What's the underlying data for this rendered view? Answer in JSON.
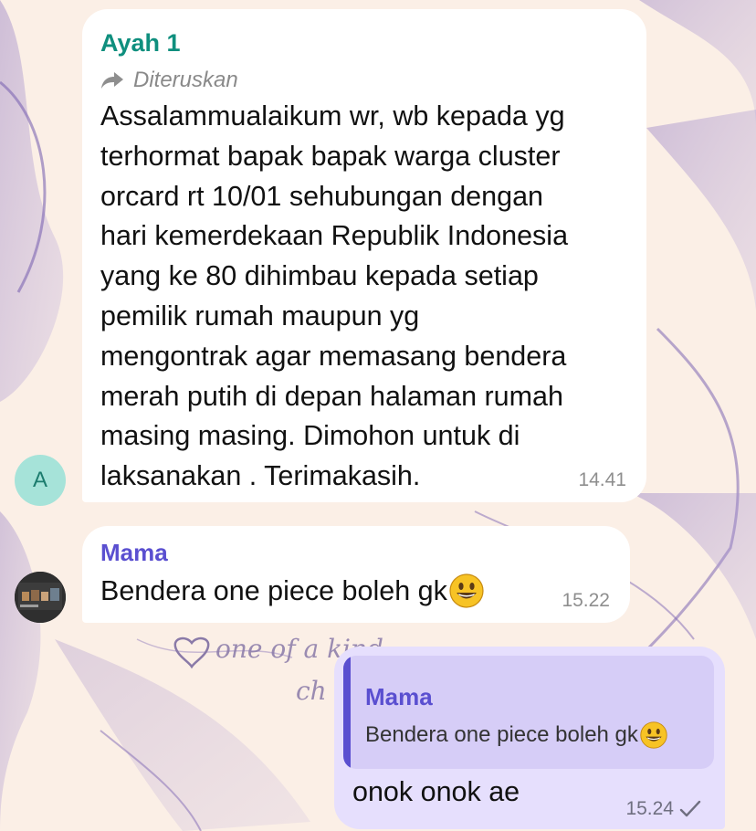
{
  "conversation": {
    "wallpaper": {
      "text_line1": "one of a kind",
      "text_line2": "ch"
    },
    "messages": [
      {
        "sender": "Ayah 1",
        "forwarded_label": "Diteruskan",
        "avatar_letter": "A",
        "text": "Assalammualaikum wr, wb kepada yg\nterhormat bapak bapak warga cluster\norcard rt 10/01 sehubungan dengan\nhari kemerdekaan Republik Indonesia\nyang ke 80 dihimbau kepada setiap\npemilik rumah maupun yg\nmengontrak agar memasang bendera\nmerah putih di depan halaman rumah\nmasing masing. Dimohon untuk di\nlaksanakan . Terimakasih.",
        "time": "14.41"
      },
      {
        "sender": "Mama",
        "text": "Bendera one piece boleh gk",
        "emoji": "grinning-face",
        "time": "15.22"
      },
      {
        "quoted_sender": "Mama",
        "quoted_text": "Bendera one piece boleh gk",
        "quoted_emoji": "grinning-face",
        "text": "onok onok ae",
        "time": "15.24",
        "status": "sent-check"
      }
    ]
  },
  "colors": {
    "ayah_name": "#0f8f7e",
    "mama_name": "#5a4fd0",
    "own_bubble": "#e6dffd",
    "quote_bg": "#d6cdf7",
    "wallpaper_bg": "#fbefe6",
    "wallpaper_flower": "#9b86c6"
  }
}
